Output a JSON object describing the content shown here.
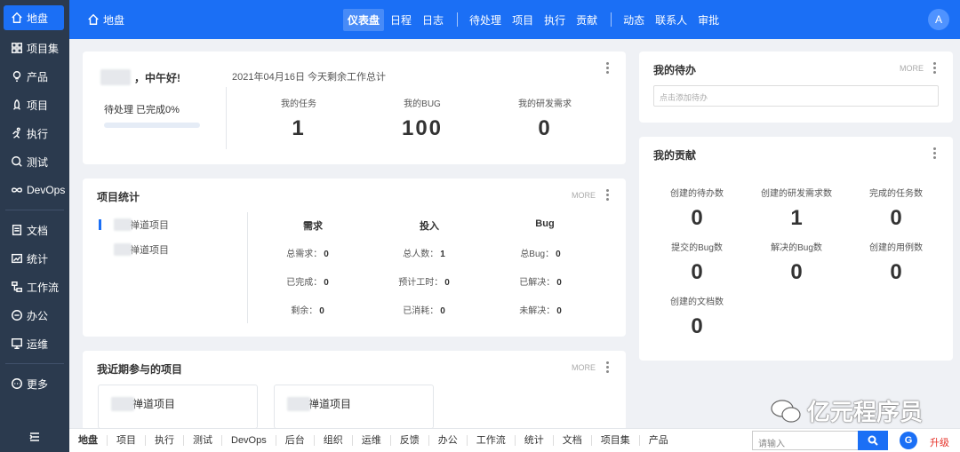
{
  "sidebar": {
    "items": [
      {
        "label": "地盘",
        "icon": "home-icon"
      },
      {
        "label": "项目集",
        "icon": "grid-icon"
      },
      {
        "label": "产品",
        "icon": "bulb-icon"
      },
      {
        "label": "项目",
        "icon": "rocket-icon"
      },
      {
        "label": "执行",
        "icon": "run-icon"
      },
      {
        "label": "测试",
        "icon": "magnifier-icon"
      },
      {
        "label": "DevOps",
        "icon": "infinity-icon"
      },
      {
        "label": "文档",
        "icon": "document-icon"
      },
      {
        "label": "统计",
        "icon": "chart-icon"
      },
      {
        "label": "工作流",
        "icon": "workflow-icon"
      },
      {
        "label": "办公",
        "icon": "oa-icon"
      },
      {
        "label": "运维",
        "icon": "ops-icon"
      },
      {
        "label": "更多",
        "icon": "more-icon"
      }
    ]
  },
  "header": {
    "home_label": "地盘",
    "nav": [
      "仪表盘",
      "日程",
      "日志",
      "待处理",
      "项目",
      "执行",
      "贡献",
      "动态",
      "联系人",
      "审批"
    ],
    "active_nav": "仪表盘",
    "avatar_letter": "A"
  },
  "greeting": {
    "greeting_text": "，中午好!",
    "status": "待处理 已完成0%",
    "progress_fraction": 0,
    "date_summary": "2021年04月16日   今天剩余工作总计",
    "stats": [
      {
        "label": "我的任务",
        "value": "1"
      },
      {
        "label": "我的BUG",
        "value": "100"
      },
      {
        "label": "我的研发需求",
        "value": "0"
      }
    ]
  },
  "project_stats": {
    "title": "项目统计",
    "more": "MORE",
    "projects": [
      "禅道项目",
      "禅道项目"
    ],
    "columns": [
      {
        "head": "需求",
        "rows": [
          {
            "k": "总需求：",
            "v": "0"
          },
          {
            "k": "已完成：",
            "v": "0"
          },
          {
            "k": "剩余：",
            "v": "0"
          }
        ]
      },
      {
        "head": "投入",
        "rows": [
          {
            "k": "总人数：",
            "v": "1"
          },
          {
            "k": "预计工时：",
            "v": "0"
          },
          {
            "k": "已消耗：",
            "v": "0"
          }
        ]
      },
      {
        "head": "Bug",
        "rows": [
          {
            "k": "总Bug：",
            "v": "0"
          },
          {
            "k": "已解决：",
            "v": "0"
          },
          {
            "k": "未解决：",
            "v": "0"
          }
        ]
      }
    ]
  },
  "recent_projects": {
    "title": "我近期参与的项目",
    "more": "MORE",
    "items": [
      "禅道项目",
      "禅道项目"
    ]
  },
  "todo": {
    "title": "我的待办",
    "more": "MORE",
    "placeholder": "点击添加待办"
  },
  "contribution": {
    "title": "我的贡献",
    "items": [
      {
        "label": "创建的待办数",
        "value": "0"
      },
      {
        "label": "创建的研发需求数",
        "value": "1"
      },
      {
        "label": "完成的任务数",
        "value": "0"
      },
      {
        "label": "提交的Bug数",
        "value": "0"
      },
      {
        "label": "解决的Bug数",
        "value": "0"
      },
      {
        "label": "创建的用例数",
        "value": "0"
      },
      {
        "label": "创建的文档数",
        "value": "0"
      }
    ]
  },
  "bottom_bar": {
    "items": [
      "地盘",
      "项目",
      "执行",
      "测试",
      "DevOps",
      "后台",
      "组织",
      "运维",
      "反馈",
      "办公",
      "工作流",
      "统计",
      "文档",
      "项目集",
      "产品"
    ],
    "active": "地盘",
    "search_placeholder": "请输入",
    "upgrade_label": "升级"
  },
  "watermark": "亿元程序员"
}
